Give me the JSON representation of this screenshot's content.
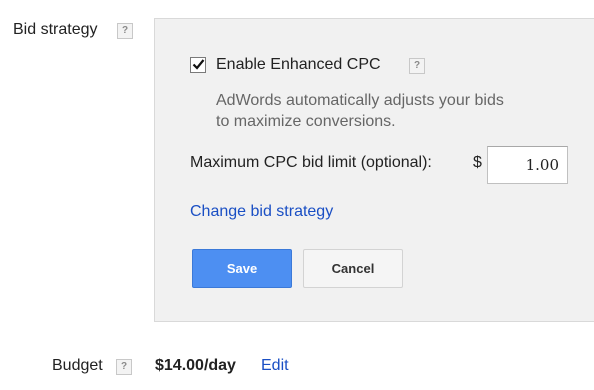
{
  "bid_strategy": {
    "label": "Bid strategy",
    "help": "?",
    "enhanced_cpc": {
      "checked": true,
      "label": "Enable Enhanced CPC",
      "help": "?",
      "description_line1": "AdWords automatically adjusts your bids",
      "description_line2": "to maximize conversions."
    },
    "max_cpc": {
      "label": "Maximum CPC bid limit (optional):",
      "currency": "$",
      "value": "1.00"
    },
    "change_link": "Change bid strategy",
    "save_label": "Save",
    "cancel_label": "Cancel"
  },
  "budget": {
    "label": "Budget",
    "help": "?",
    "value": "$14.00/day",
    "edit_label": "Edit"
  },
  "colors": {
    "panel_bg": "#f1f1f1",
    "save_button": "#4d8ff2",
    "link": "#1a4fc4"
  }
}
